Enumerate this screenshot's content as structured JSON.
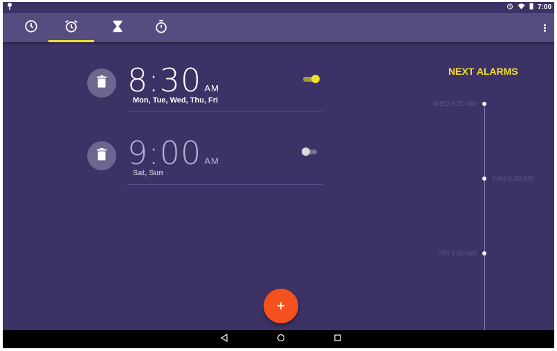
{
  "status_bar": {
    "time": "7:00"
  },
  "tabs": [
    {
      "name": "clock-icon"
    },
    {
      "name": "alarm-icon",
      "active": true
    },
    {
      "name": "hourglass-icon"
    },
    {
      "name": "stopwatch-icon"
    }
  ],
  "alarms": [
    {
      "time": "8:30",
      "ampm": "AM",
      "days": "Mon, Tue, Wed, Thu, Fri",
      "enabled": true
    },
    {
      "time": "9:00",
      "ampm": "AM",
      "days": "Sat, Sun",
      "enabled": false
    }
  ],
  "next_alarms": {
    "title": "NEXT ALARMS",
    "items": [
      {
        "label": "WED 8:30 AM"
      },
      {
        "label": "THU 8:30 AM"
      },
      {
        "label": "FRI 8:30 AM"
      }
    ]
  },
  "fab": {
    "label": "+"
  },
  "colors": {
    "background": "#3d3266",
    "toolbar": "#574c80",
    "accent": "#f2e230",
    "fab": "#f4511e"
  }
}
